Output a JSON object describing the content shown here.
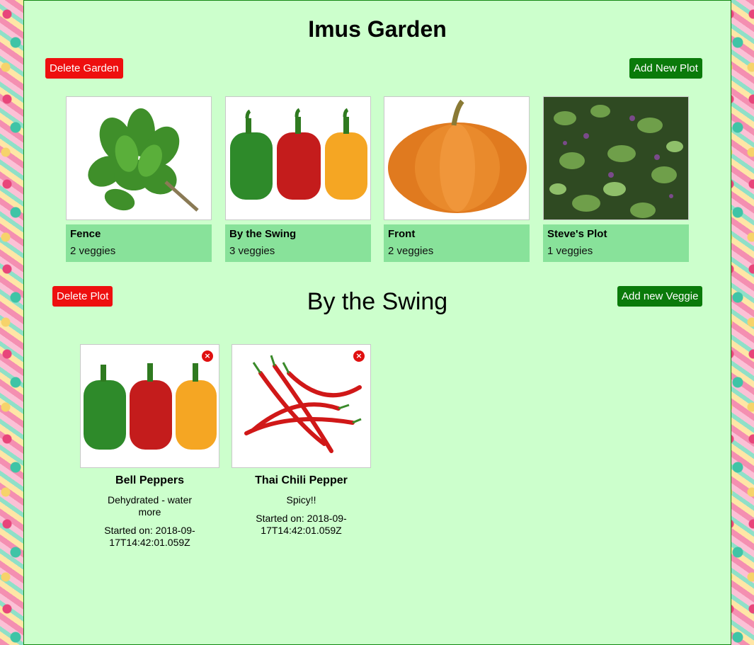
{
  "garden": {
    "title": "Imus Garden",
    "delete_label": "Delete Garden",
    "add_plot_label": "Add New Plot"
  },
  "plots": [
    {
      "name": "Fence",
      "count": "2 veggies",
      "image": "basil"
    },
    {
      "name": "By the Swing",
      "count": "3 veggies",
      "image": "bell-peppers"
    },
    {
      "name": "Front",
      "count": "2 veggies",
      "image": "pumpkin"
    },
    {
      "name": "Steve's Plot",
      "count": "1 veggies",
      "image": "basil-plant"
    }
  ],
  "selected_plot": {
    "title": "By the Swing",
    "delete_label": "Delete Plot",
    "add_veggie_label": "Add new Veggie"
  },
  "veggies": [
    {
      "name": "Bell Peppers",
      "note": "Dehydrated - water more",
      "started": "Started on: 2018-09-17T14:42:01.059Z",
      "image": "bell-peppers",
      "remove_icon": "×"
    },
    {
      "name": "Thai Chili Pepper",
      "note": "Spicy!!",
      "started": "Started on: 2018-09-17T14:42:01.059Z",
      "image": "chili-peppers",
      "remove_icon": "×"
    }
  ],
  "colors": {
    "page_bg": "#ccffcc",
    "danger": "#ee0f0f",
    "success": "#0a7a0a",
    "plot_info_bg": "#88e29a"
  }
}
